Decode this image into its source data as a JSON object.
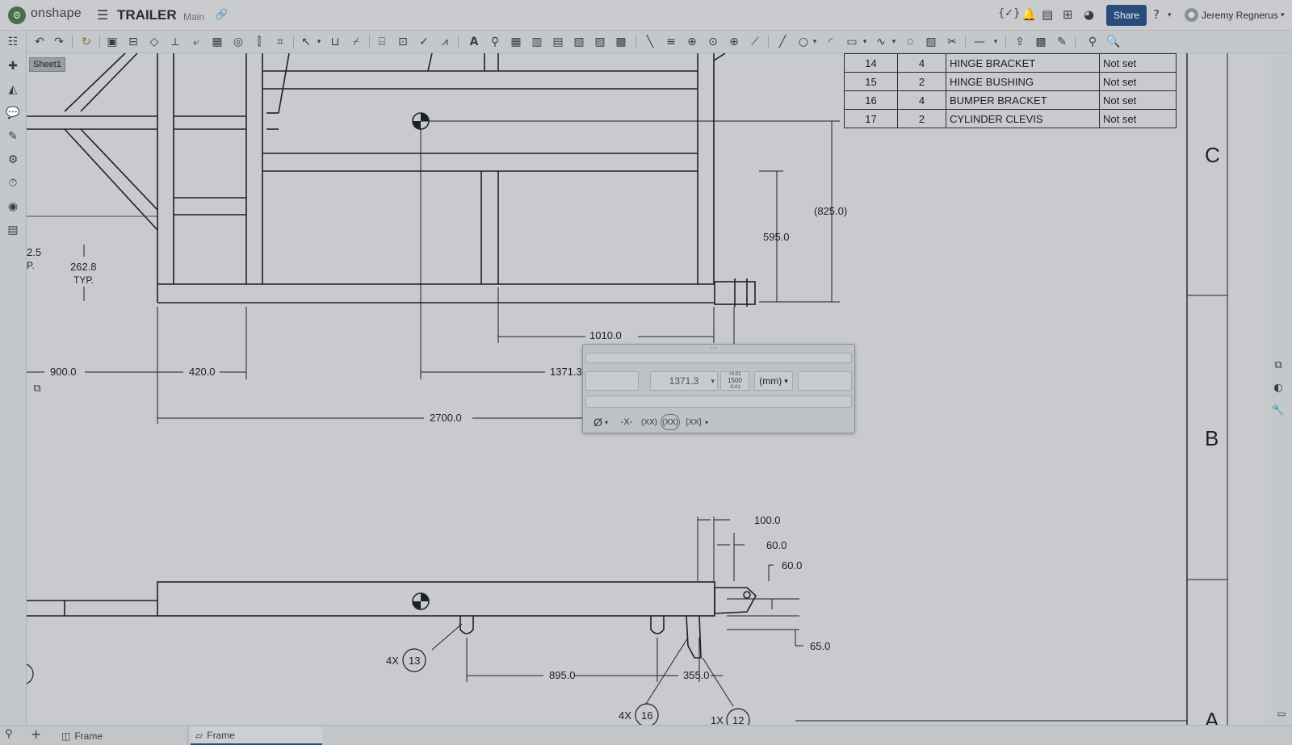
{
  "app": {
    "brand": "onshape",
    "doc_title": "TRAILER",
    "branch": "Main"
  },
  "header": {
    "share_label": "Share",
    "user_name": "Jeremy Regnerus",
    "code_glyph": "{✓}"
  },
  "sheet": {
    "name": "Sheet1"
  },
  "bom": {
    "rows": [
      {
        "item": "14",
        "qty": "4",
        "desc": "HINGE BRACKET",
        "material": "Not set"
      },
      {
        "item": "15",
        "qty": "2",
        "desc": "HINGE BUSHING",
        "material": "Not set"
      },
      {
        "item": "16",
        "qty": "4",
        "desc": "BUMPER BRACKET",
        "material": "Not set"
      },
      {
        "item": "17",
        "qty": "2",
        "desc": "CYLINDER CLEVIS",
        "material": "Not set"
      }
    ]
  },
  "drawing": {
    "dims": {
      "d_825": "(825.0)",
      "d_595": "595.0",
      "d_2628": "262.8",
      "typ": "TYP.",
      "d_25": "2.5",
      "p_frag": "P.",
      "d_1010": "1010.0",
      "d_1371": "1371.3",
      "d_900": "900.0",
      "d_420": "420.0",
      "d_2700": "2700.0",
      "d_100": "100.0",
      "d_60a": "60.0",
      "d_60b": "60.0",
      "d_65": "65.0",
      "d_895": "895.0",
      "d_355": "355.0"
    },
    "balloons": {
      "b13_qty": "4X",
      "b13_num": "13",
      "b16_qty": "4X",
      "b16_num": "16",
      "b12_qty": "1X",
      "b12_num": "12"
    },
    "zones": {
      "c": "C",
      "b": "B",
      "a": "A"
    }
  },
  "dimension_dialog": {
    "value": "1371.3",
    "tolerance_label": "1500",
    "tolerance_top": "+0.01",
    "tolerance_bottom": "-0.01",
    "units": "(mm)",
    "diameter_symbol": "Ø",
    "btn_x": "-X-",
    "btn_paren": "(XX)",
    "btn_basic": "(XX)",
    "btn_insp": "[XX]"
  },
  "tabs": [
    {
      "label": "Frame"
    },
    {
      "label": "Frame"
    }
  ],
  "colors": {
    "share_bg": "#2a4c7d",
    "active_tab_underline": "#2a4c7d"
  }
}
